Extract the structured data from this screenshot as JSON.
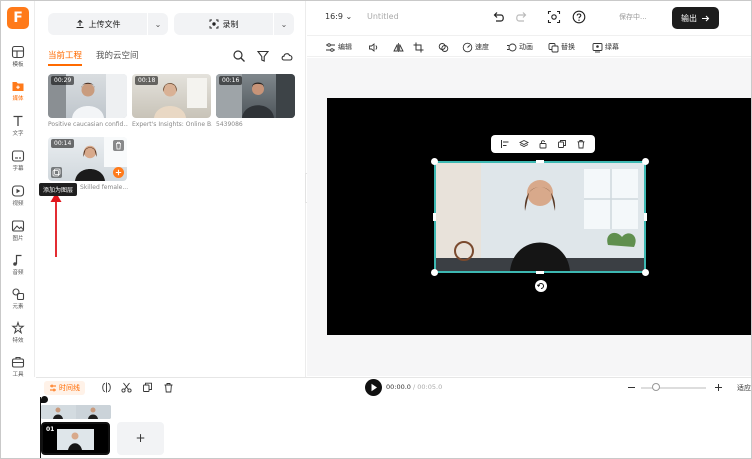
{
  "app": {
    "logo_letter": "F"
  },
  "rail": {
    "items": [
      {
        "label": "模板",
        "icon": "template-icon",
        "active": false
      },
      {
        "label": "媒体",
        "icon": "media-folder-icon",
        "active": true
      },
      {
        "label": "文字",
        "icon": "text-icon",
        "active": false
      },
      {
        "label": "字幕",
        "icon": "subtitle-icon",
        "active": false
      },
      {
        "label": "视频",
        "icon": "video-icon",
        "active": false
      },
      {
        "label": "图片",
        "icon": "image-icon",
        "active": false
      },
      {
        "label": "音频",
        "icon": "music-icon",
        "active": false
      },
      {
        "label": "元素",
        "icon": "elements-icon",
        "active": false
      },
      {
        "label": "特效",
        "icon": "effects-icon",
        "active": false
      },
      {
        "label": "工具",
        "icon": "tools-icon",
        "active": false
      }
    ]
  },
  "panel": {
    "upload_label": "上传文件",
    "record_label": "录制",
    "tabs": [
      {
        "label": "当前工程",
        "active": true
      },
      {
        "label": "我的云空间",
        "active": false
      }
    ],
    "media": [
      {
        "duration": "00:29",
        "caption": "Positive caucasian confid..."
      },
      {
        "duration": "00:18",
        "caption": "Expert's Insights: Online B..."
      },
      {
        "duration": "00:16",
        "caption": "5439086"
      },
      {
        "duration": "00:14",
        "caption": "Skilled female..."
      }
    ],
    "tooltip": "添加为图层"
  },
  "topbar": {
    "ratio": "16:9",
    "title": "Untitled",
    "saving": "保存中...",
    "export_label": "输出"
  },
  "toolbar": {
    "items": [
      {
        "label": "编辑",
        "icon": "adjust-sliders-icon"
      },
      {
        "label": "",
        "icon": "volume-icon"
      },
      {
        "label": "",
        "icon": "flip-icon"
      },
      {
        "label": "",
        "icon": "crop-icon"
      },
      {
        "label": "",
        "icon": "blend-icon"
      },
      {
        "label": "速度",
        "icon": "speed-icon"
      },
      {
        "label": "动画",
        "icon": "animation-icon"
      },
      {
        "label": "替换",
        "icon": "replace-icon"
      },
      {
        "label": "绿幕",
        "icon": "green-screen-icon"
      }
    ]
  },
  "timeline": {
    "mode_label": "时间线",
    "current_time": "00:00.0",
    "total_time": "00:05.0",
    "fit_label": "适应",
    "clip_number": "01",
    "add_symbol": "+"
  },
  "colors": {
    "accent": "#ff6a00",
    "selection": "#3db8b2",
    "canvas": "#000000",
    "export_bg": "#1d1d1d"
  }
}
